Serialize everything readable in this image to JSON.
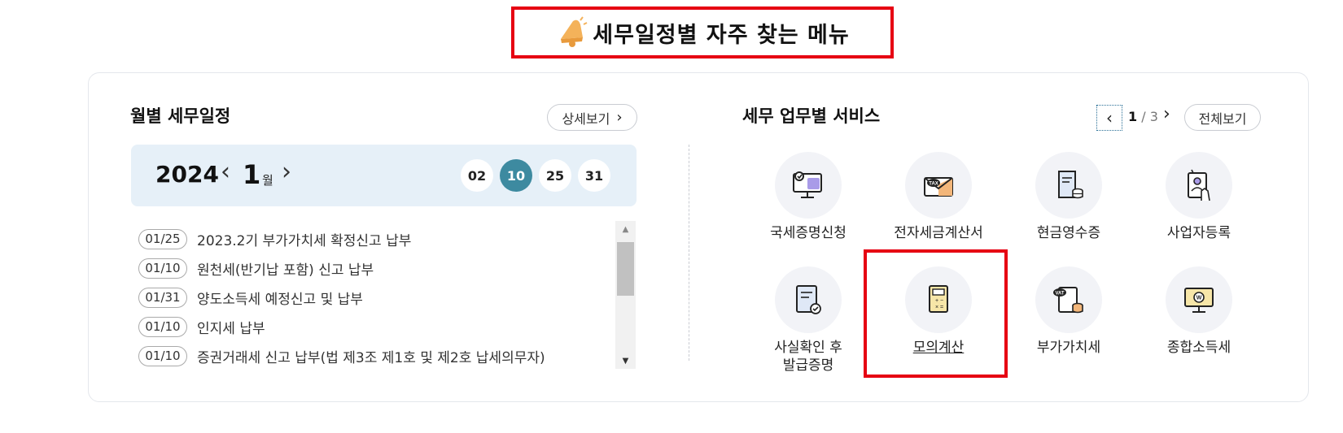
{
  "header": {
    "title": "세무일정별 자주 찾는 메뉴",
    "icon": "bell-icon"
  },
  "schedule": {
    "title": "월별 세무일정",
    "detail_label": "상세보기",
    "year": "2024",
    "month": "1",
    "month_unit": "월",
    "days": [
      "02",
      "10",
      "25",
      "31"
    ],
    "active_day": "10",
    "items": [
      {
        "date": "01/25",
        "text": "2023.2기 부가가치세 확정신고 납부"
      },
      {
        "date": "01/10",
        "text": "원천세(반기납 포함) 신고 납부"
      },
      {
        "date": "01/31",
        "text": "양도소득세 예정신고 및 납부"
      },
      {
        "date": "01/10",
        "text": "인지세 납부"
      },
      {
        "date": "01/10",
        "text": "증권거래세 신고 납부(법 제3조 제1호 및 제2호 납세의무자)"
      }
    ]
  },
  "services": {
    "title": "세무 업무별 서비스",
    "page_current": "1",
    "page_total": "3",
    "all_label": "전체보기",
    "items": [
      {
        "label": "국세증명신청",
        "icon": "certificate-monitor-icon"
      },
      {
        "label": "전자세금계산서",
        "icon": "tax-envelope-icon"
      },
      {
        "label": "현금영수증",
        "icon": "receipt-coins-icon"
      },
      {
        "label": "사업자등록",
        "icon": "business-registration-icon"
      },
      {
        "label": "사실확인 후",
        "label2": "발급증명",
        "icon": "verified-document-icon"
      },
      {
        "label": "모의계산",
        "icon": "calculator-icon"
      },
      {
        "label": "부가가치세",
        "icon": "vat-coins-icon"
      },
      {
        "label": "종합소득세",
        "icon": "won-monitor-icon"
      }
    ]
  },
  "colors": {
    "accent": "#3d8aa0",
    "highlight": "#e60012",
    "date_bar_bg": "#e6f0f8"
  }
}
